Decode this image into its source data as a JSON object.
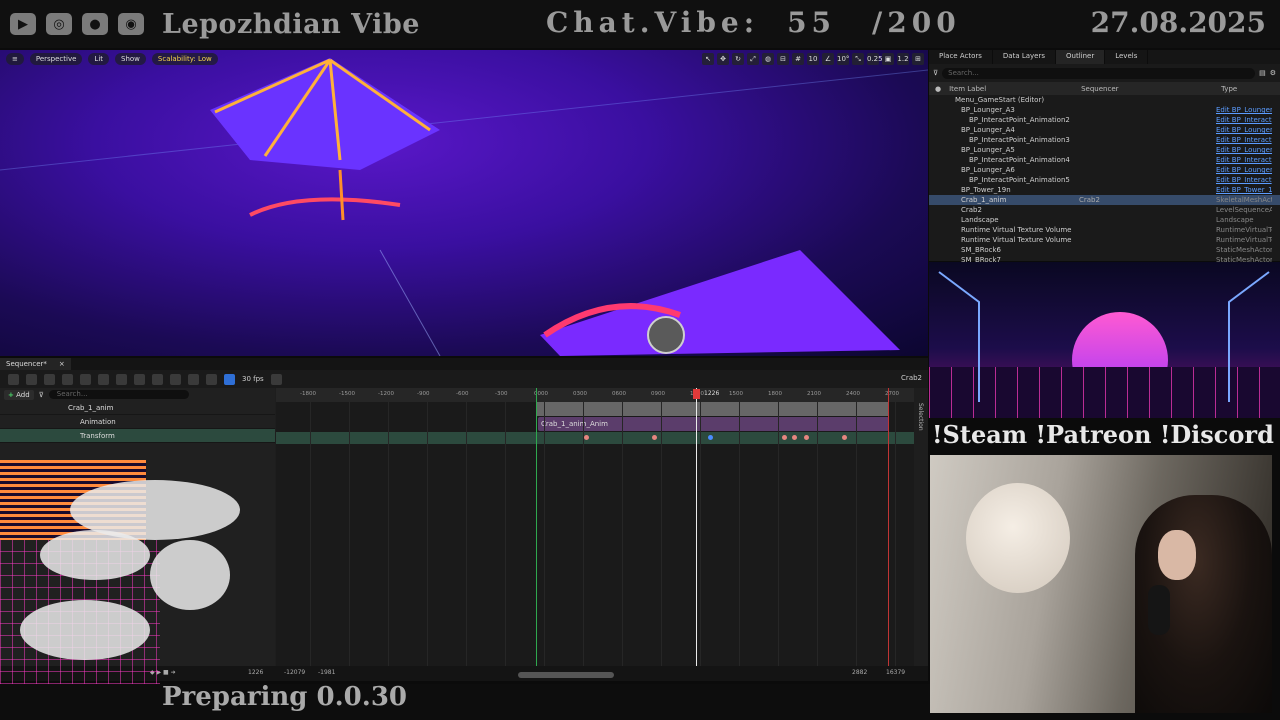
{
  "stream": {
    "channel": "Lepozhdian Vibe",
    "chat_label": "Chat.Vibe:",
    "chat_count": "55",
    "chat_max": "/200",
    "date": "27.08.2025",
    "social": "!Steam !Patreon !Discord",
    "status": "Preparing 0.0.30",
    "icons": [
      "youtube-icon",
      "steam-icon",
      "patreon-icon",
      "discord-icon"
    ]
  },
  "viewport": {
    "perspective": "Perspective",
    "lit": "Lit",
    "show": "Show",
    "scalability": "Scalability: Low",
    "grid_value": "10",
    "angle_value": "10°",
    "scale_value": "0.25",
    "speed_value": "1.2"
  },
  "outliner": {
    "tabs": [
      "Place Actors",
      "Data Layers",
      "Outliner",
      "Levels"
    ],
    "search_placeholder": "Search...",
    "col_label": "Item Label",
    "col_sequencer": "Sequencer",
    "col_type": "Type",
    "rows": [
      {
        "label": "Menu_GameStart (Editor)",
        "seq": "",
        "type": ""
      },
      {
        "label": "BP_Lounger_A3",
        "seq": "",
        "type": "Edit BP_Lounger_"
      },
      {
        "label": "BP_InteractPoint_Animation2",
        "seq": "",
        "type": "Edit BP_Interact"
      },
      {
        "label": "BP_Lounger_A4",
        "seq": "",
        "type": "Edit BP_Lounger_"
      },
      {
        "label": "BP_InteractPoint_Animation3",
        "seq": "",
        "type": "Edit BP_Interact"
      },
      {
        "label": "BP_Lounger_A5",
        "seq": "",
        "type": "Edit BP_Lounger_"
      },
      {
        "label": "BP_InteractPoint_Animation4",
        "seq": "",
        "type": "Edit BP_Interact"
      },
      {
        "label": "BP_Lounger_A6",
        "seq": "",
        "type": "Edit BP_Lounger_"
      },
      {
        "label": "BP_InteractPoint_Animation5",
        "seq": "",
        "type": "Edit BP_Interact"
      },
      {
        "label": "BP_Tower_19n",
        "seq": "",
        "type": "Edit BP_Tower_1"
      },
      {
        "label": "Crab_1_anim",
        "seq": "Crab2",
        "type": "SkeletalMeshActo"
      },
      {
        "label": "Crab2",
        "seq": "",
        "type": "LevelSequenceAc"
      },
      {
        "label": "Landscape",
        "seq": "",
        "type": "Landscape"
      },
      {
        "label": "Runtime Virtual Texture Volume",
        "seq": "",
        "type": "RuntimeVirtualTe"
      },
      {
        "label": "Runtime Virtual Texture Volume",
        "seq": "",
        "type": "RuntimeVirtualTe"
      },
      {
        "label": "SM_BRock6",
        "seq": "",
        "type": "StaticMeshActor"
      },
      {
        "label": "SM_BRock7",
        "seq": "",
        "type": "StaticMeshActor"
      }
    ]
  },
  "sequencer": {
    "tab": "Sequencer*",
    "fps": "30 fps",
    "camera": "Crab2",
    "add_label": "Add",
    "search_placeholder": "Search...",
    "tracks": [
      "Crab_1_anim",
      "Animation",
      "Transform"
    ],
    "clip_label": "Crab_1_anim_Anim",
    "playhead_value": "1226",
    "ruler_ticks": [
      "-1800",
      "-1500",
      "-1200",
      "-900",
      "-600",
      "-300",
      "0000",
      "0300",
      "0600",
      "0900",
      "1200",
      "1500",
      "1800",
      "2100",
      "2400",
      "2700"
    ],
    "current_frame": "1226",
    "range_start": "-12079",
    "range_view_start": "-1981",
    "range_view_end": "2882",
    "range_end": "16379",
    "selection_label": "Selection"
  }
}
